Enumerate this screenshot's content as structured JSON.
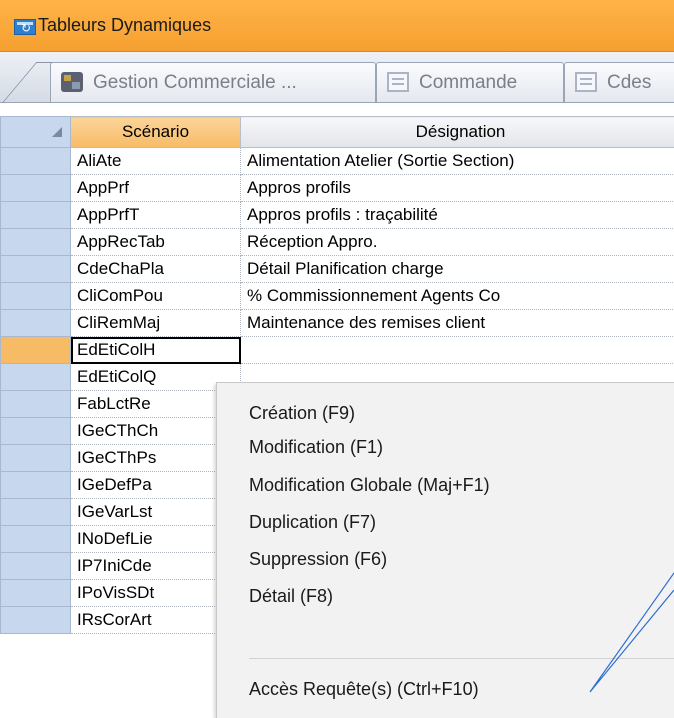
{
  "window": {
    "title": "Tableurs Dynamiques"
  },
  "tabs": [
    {
      "label": "Gestion Commerciale ..."
    },
    {
      "label": "Commande"
    },
    {
      "label": "Cdes"
    }
  ],
  "grid": {
    "headers": {
      "scenario": "Scénario",
      "designation": "Désignation"
    },
    "rows": [
      {
        "code": "AliAte",
        "designation": "Alimentation Atelier (Sortie Section)"
      },
      {
        "code": "AppPrf",
        "designation": "Appros profils"
      },
      {
        "code": "AppPrfT",
        "designation": "Appros profils : traçabilité"
      },
      {
        "code": "AppRecTab",
        "designation": "Réception Appro."
      },
      {
        "code": "CdeChaPla",
        "designation": "Détail Planification charge"
      },
      {
        "code": "CliComPou",
        "designation": "% Commissionnement Agents Co"
      },
      {
        "code": "CliRemMaj",
        "designation": "Maintenance des remises client"
      },
      {
        "code": "EdEtiColH",
        "designation": ""
      },
      {
        "code": "EdEtiColQ",
        "designation": ""
      },
      {
        "code": "FabLctRe",
        "designation": ""
      },
      {
        "code": "IGeCThCh",
        "designation": ""
      },
      {
        "code": "IGeCThPs",
        "designation": ""
      },
      {
        "code": "IGeDefPa",
        "designation": ""
      },
      {
        "code": "IGeVarLst",
        "designation": ""
      },
      {
        "code": "INoDefLie",
        "designation": ""
      },
      {
        "code": "IP7IniCde",
        "designation": ""
      },
      {
        "code": "IPoVisSDt",
        "designation": ""
      },
      {
        "code": "IRsCorArt",
        "designation": ""
      }
    ]
  },
  "context_menu": {
    "items": [
      "Création (F9)",
      "Modification (F1)",
      "Modification Globale (Maj+F1)",
      "Duplication (F7)",
      "Suppression (F6)",
      "Détail (F8)"
    ],
    "footer_item": "Accès Requête(s) (Ctrl+F10)"
  },
  "colors": {
    "title_bar": "#f5a030",
    "selected_header": "#f7bb65",
    "row_header": "#c6d7ee",
    "callout_line": "#2f6fd0"
  },
  "icons": [
    "app-icon",
    "database-icon",
    "document-icon"
  ]
}
